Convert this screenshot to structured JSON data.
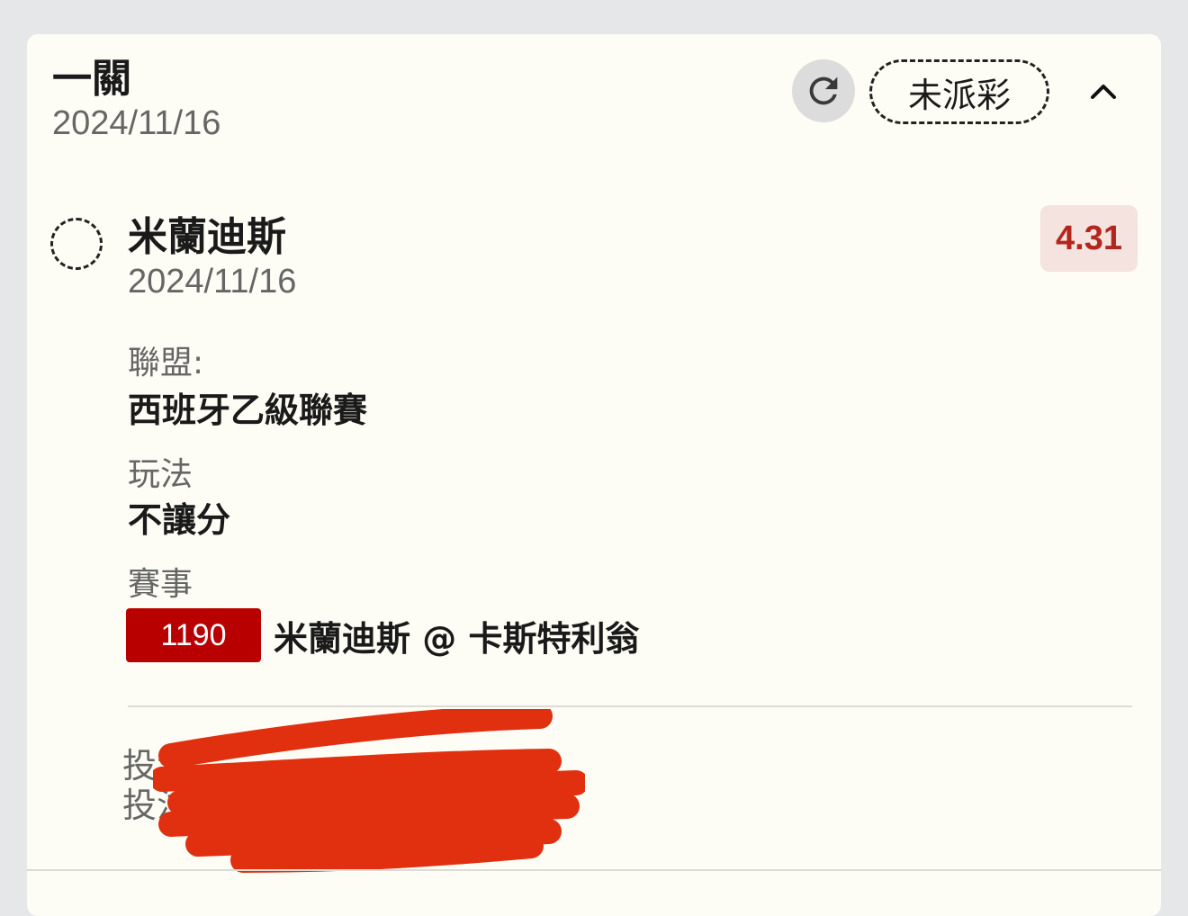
{
  "header": {
    "title": "一關",
    "date": "2024/11/16",
    "status_label": "未派彩",
    "refresh_icon": "refresh-icon",
    "collapse_icon": "chevron-up-icon"
  },
  "selection": {
    "name": "米蘭迪斯",
    "date": "2024/11/16",
    "odds": "4.31"
  },
  "details": {
    "league_label": "聯盟:",
    "league_value": "西班牙乙級聯賽",
    "bet_type_label": "玩法",
    "bet_type_value": "不讓分",
    "match_label": "賽事",
    "match_id": "1190",
    "match_name": "米蘭迪斯 @ 卡斯特利翁"
  },
  "bet_info": {
    "line1_visible": "投注",
    "line2_visible": "投注"
  },
  "colors": {
    "background": "#e6e7e9",
    "card": "#fdfcf5",
    "match_badge": "#b80000",
    "odds_text": "#b3261e",
    "odds_bg": "#f4e3de",
    "redaction": "#e03010"
  }
}
